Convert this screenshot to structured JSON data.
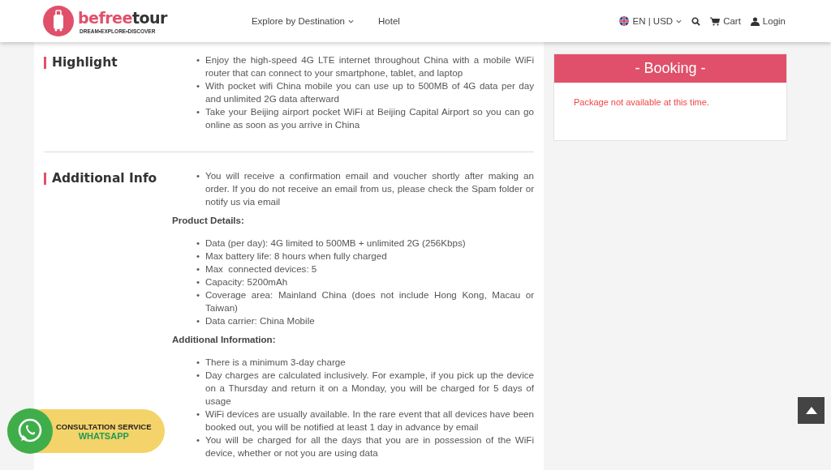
{
  "header": {
    "logo": {
      "brand_first": "befree",
      "brand_second": "tour",
      "tagline": "DREAM•EXPLORE•DISCOVER"
    },
    "nav": [
      {
        "label": "Explore by Destination",
        "dropdown": true
      },
      {
        "label": "Hotel",
        "dropdown": false
      }
    ],
    "locale": "EN | USD",
    "cart": "Cart",
    "login": "Login"
  },
  "sections": [
    {
      "title": "Highlight",
      "blocks": [
        {
          "kind": "list",
          "marker": "•",
          "items": [
            "Enjoy the high-speed 4G LTE internet throughout China with a mobile WiFi router that can connect to your smartphone, tablet, and laptop",
            "With pocket wifi China mobile you can use up to 500MB of 4G data per day and unlimited 2G data afterward",
            "Take your Beijing airport pocket WiFi at Beijing Capital Airport so you can go online as soon as you arrive in China"
          ]
        }
      ]
    },
    {
      "title": "Additional Info",
      "blocks": [
        {
          "kind": "list",
          "marker": "•",
          "items": [
            "You will receive a confirmation email and voucher shortly after making an order. If you do not receive an email from us, please check the Spam folder or notify us via email"
          ]
        },
        {
          "kind": "heading",
          "text": "Product Details:"
        },
        {
          "kind": "list",
          "marker": "•",
          "items": [
            "Data (per day): 4G limited to 500MB + unlimited 2G (256Kbps)",
            "Max battery life: 8 hours when fully charged",
            "Max  connected devices: 5",
            "Capacity: 5200mAh",
            "Coverage area: Mainland China (does not include Hong Kong, Macau or Taiwan)",
            "Data carrier: China Mobile"
          ]
        },
        {
          "kind": "heading",
          "text": "Additional Information:"
        },
        {
          "kind": "list",
          "marker": "•",
          "items": [
            "There is a minimum 3-day charge",
            "Day charges are calculated inclusively. For example, if you pick up the device on a Thursday and return it on a Monday, you will be charged for 5 days of usage",
            "WiFi devices are usually available. In the rare event that all devices have been booked out, you will be notified at least 1 day in advance by email",
            "You will be charged for all the days that you are in possession of the WiFi device, whether or not you are using data"
          ]
        }
      ]
    }
  ],
  "booking": {
    "title": "- Booking -",
    "message": "Package not available at this time."
  },
  "whatsapp": {
    "line1": "CONSULTATION SERVICE",
    "line2": "WHATSAPP"
  }
}
